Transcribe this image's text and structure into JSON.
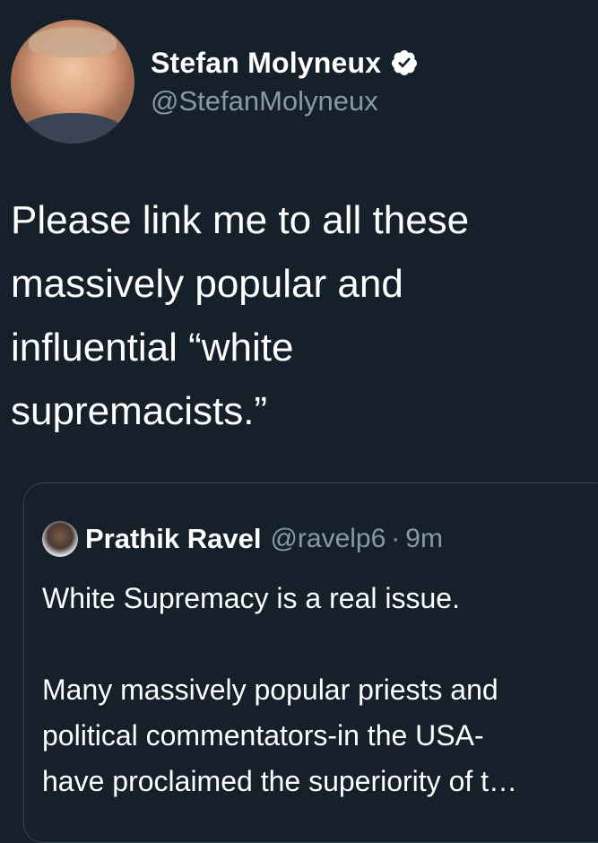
{
  "tweet": {
    "author": {
      "display_name": "Stefan Molyneux",
      "handle": "@StefanMolyneux",
      "verified": true
    },
    "text": "Please link me to all these\nmassively popular and\ninfluential “white\nsupremacists.”"
  },
  "quoted_tweet": {
    "author": {
      "display_name": "Prathik Ravel",
      "handle": "@ravelp6"
    },
    "separator": "·",
    "time": "9m",
    "text": "White Supremacy is a real issue.\n\nMany massively popular priests and\npolitical commentators-in the USA-\nhave proclaimed the superiority of t…"
  },
  "colors": {
    "background": "#15202b",
    "text": "#ffffff",
    "secondary_text": "#8899a6",
    "border": "#38444d"
  },
  "icons": {
    "verified": "verified-badge-icon"
  }
}
